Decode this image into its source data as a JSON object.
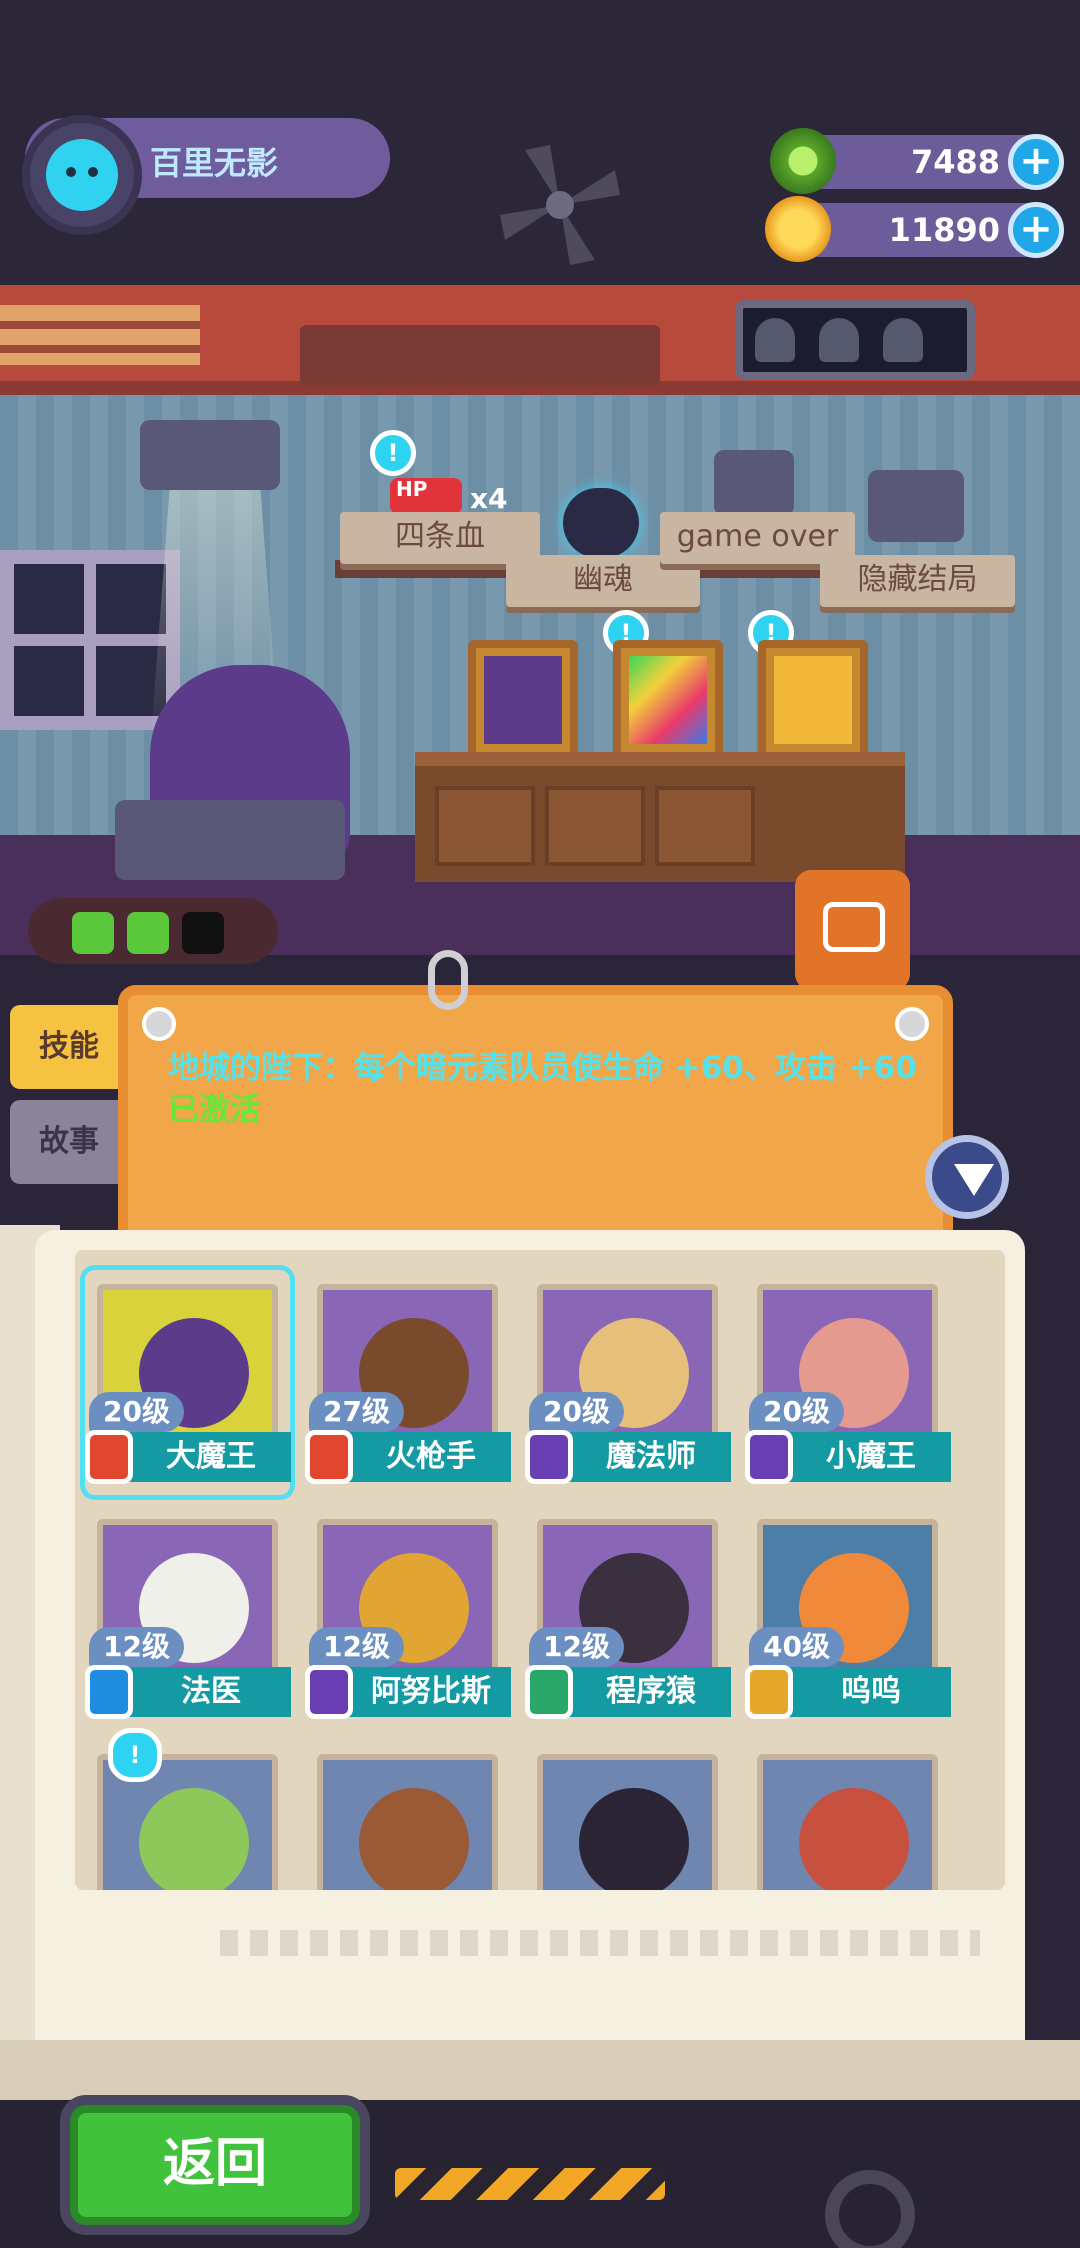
{
  "profile": {
    "name": "百里无影"
  },
  "currency": {
    "gems": "7488",
    "coins": "11890",
    "plus_label": "+"
  },
  "plaques": {
    "four_hp": "四条血",
    "hp_multiplier": "x4",
    "hp_label": "HP",
    "ghost": "幽魂",
    "game_over": "game over",
    "hidden_ending": "隐藏结局"
  },
  "hint_symbol": "!",
  "side_tabs": {
    "skill": "技能",
    "story": "故事"
  },
  "info": {
    "text": "地城的陛下：每个暗元素队员使生命 +60、攻击 +60",
    "status": "已激活"
  },
  "characters": [
    {
      "level": "20级",
      "name": "大魔王",
      "head_color": "#5b3b8a",
      "bg": "#d9d23a",
      "badge_color": "#e0472e",
      "selected": true
    },
    {
      "level": "27级",
      "name": "火枪手",
      "head_color": "#7a4a2c",
      "bg": "#8a67b6",
      "badge_color": "#e0472e",
      "selected": false
    },
    {
      "level": "20级",
      "name": "魔法师",
      "head_color": "#e6c07a",
      "bg": "#8a67b6",
      "badge_color": "#6a3fb4",
      "selected": false
    },
    {
      "level": "20级",
      "name": "小魔王",
      "head_color": "#e49a8e",
      "bg": "#8a67b6",
      "badge_color": "#6a3fb4",
      "selected": false
    },
    {
      "level": "12级",
      "name": "法医",
      "head_color": "#f0f0ea",
      "bg": "#8a67b6",
      "badge_color": "#1f8ce0",
      "selected": false
    },
    {
      "level": "12级",
      "name": "阿努比斯",
      "head_color": "#e0a532",
      "bg": "#8a67b6",
      "badge_color": "#6a3fb4",
      "selected": false
    },
    {
      "level": "12级",
      "name": "程序猿",
      "head_color": "#3a3040",
      "bg": "#8a67b6",
      "badge_color": "#2aa86a",
      "selected": false
    },
    {
      "level": "40级",
      "name": "呜呜",
      "head_color": "#f08a3a",
      "bg": "#4c7ea8",
      "badge_color": "#e6a82a",
      "selected": false
    },
    {
      "level": "",
      "name": "",
      "head_color": "#8ec85a",
      "bg": "#6e86b0",
      "badge_color": "#1f8ce0",
      "selected": false
    },
    {
      "level": "",
      "name": "",
      "head_color": "#9a5a36",
      "bg": "#6e86b0",
      "badge_color": "#1f8ce0",
      "selected": false
    },
    {
      "level": "",
      "name": "",
      "head_color": "#2a2434",
      "bg": "#6e86b0",
      "badge_color": "#1f8ce0",
      "selected": false
    },
    {
      "level": "",
      "name": "",
      "head_color": "#c8503e",
      "bg": "#6e86b0",
      "badge_color": "#1f8ce0",
      "selected": false
    }
  ],
  "bottom": {
    "back": "返回"
  },
  "colors": {
    "info_text": "#57e2ea",
    "activated": "#65e837",
    "back_button": "#40c23c"
  }
}
